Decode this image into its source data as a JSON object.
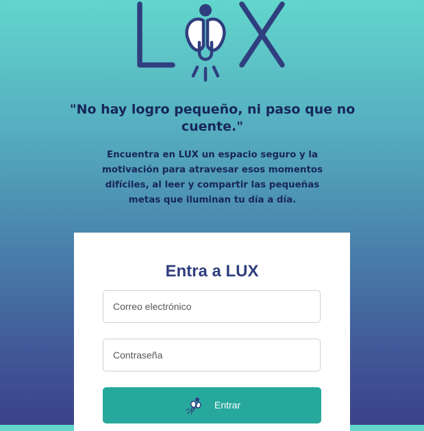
{
  "logo": {
    "text": "LUX",
    "icon": "firefly-bulb-icon",
    "color": "#2f3e7e"
  },
  "hero": {
    "quote": "\"No hay logro pequeño, ni paso que no cuente.\"",
    "description": "Encuentra en LUX un espacio seguro y la motivación para atravesar esos momentos difíciles, al leer y compartir las pequeñas metas que iluminan tu día a día."
  },
  "login": {
    "title": "Entra a LUX",
    "email_placeholder": "Correo electrónico",
    "password_placeholder": "Contraseña",
    "submit_label": "Entrar",
    "submit_icon": "firefly-icon",
    "button_color": "#27a89c"
  },
  "colors": {
    "gradient_top": "#62d6cc",
    "gradient_bottom": "#3b4288",
    "text_dark": "#17265a"
  }
}
